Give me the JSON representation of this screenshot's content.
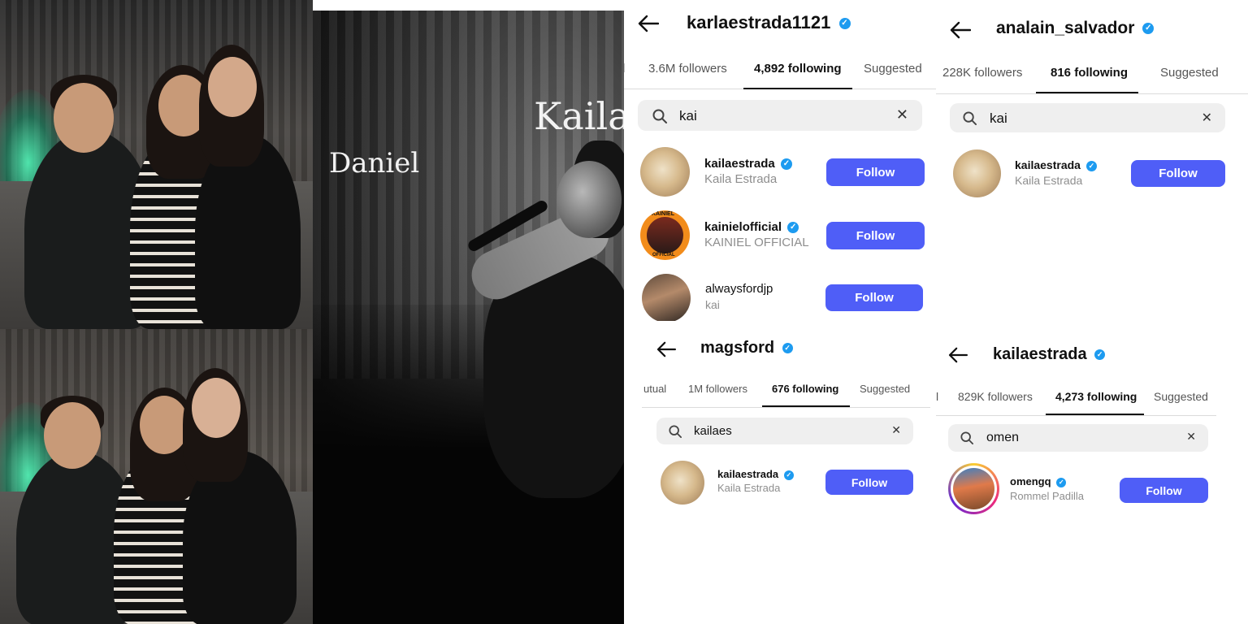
{
  "photo_overlay": {
    "name_left": "Daniel",
    "name_right": "Kaila"
  },
  "panels": [
    {
      "handle": "karlaestrada1121",
      "tabs": [
        "l",
        "3.6M followers",
        "4,892 following",
        "Suggested"
      ],
      "active_tab": "4,892 following",
      "search_query": "kai",
      "results": [
        {
          "username": "kailaestrada",
          "fullname": "Kaila Estrada",
          "verified": true,
          "button": "Follow"
        },
        {
          "username": "kainielofficial",
          "fullname": "KAINIEL OFFICIAL",
          "verified": true,
          "button": "Follow"
        },
        {
          "username": "alwaysfordjp",
          "fullname": "kai",
          "verified": false,
          "button": "Follow"
        }
      ]
    },
    {
      "handle": "analain_salvador",
      "tabs": [
        "228K followers",
        "816 following",
        "Suggested"
      ],
      "active_tab": "816 following",
      "search_query": "kai",
      "results": [
        {
          "username": "kailaestrada",
          "fullname": "Kaila Estrada",
          "verified": true,
          "button": "Follow"
        }
      ]
    },
    {
      "handle": "magsford",
      "tabs": [
        "utual",
        "1M followers",
        "676 following",
        "Suggested"
      ],
      "active_tab": "676 following",
      "search_query": "kailaes",
      "results": [
        {
          "username": "kailaestrada",
          "fullname": "Kaila Estrada",
          "verified": true,
          "button": "Follow"
        }
      ]
    },
    {
      "handle": "kailaestrada",
      "tabs": [
        "l",
        "829K followers",
        "4,273 following",
        "Suggested"
      ],
      "active_tab": "4,273 following",
      "search_query": "omen",
      "results": [
        {
          "username": "omengq",
          "fullname": "Rommel Padilla",
          "verified": true,
          "button": "Follow"
        }
      ]
    }
  ],
  "kainiel_avatar_text": "KAINIEL",
  "kainiel_avatar_subtext": "OFFICIAL",
  "colors": {
    "follow_button": "#4f5ef7",
    "verified_badge": "#1d9bf0",
    "search_bg": "#efefef"
  },
  "icons": [
    "back-arrow-icon",
    "verified-badge-icon",
    "search-icon",
    "clear-icon"
  ]
}
